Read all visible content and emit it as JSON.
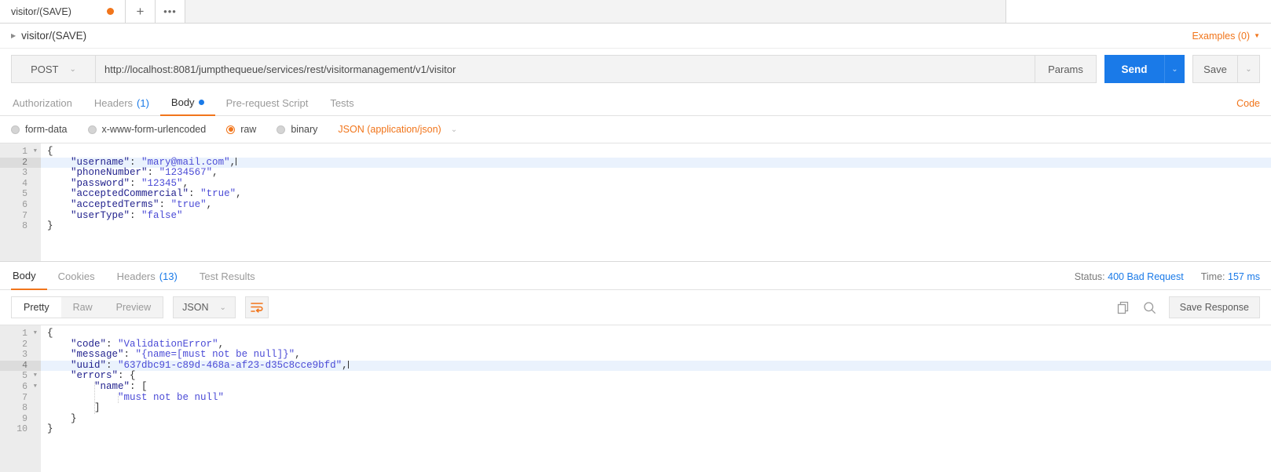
{
  "tabbar": {
    "request_tab_label": "visitor/(SAVE)",
    "unsaved_dot_color": "#f1751b",
    "new_tab_label": "+",
    "more_label": "•••"
  },
  "breadcrumb": {
    "caret": "▶",
    "label": "visitor/(SAVE)",
    "examples_label": "Examples (0)",
    "examples_caret": "▼",
    "accent_color": "#f1751b"
  },
  "urlbar": {
    "method": "POST",
    "method_caret": "⌄",
    "url": "http://localhost:8081/jumpthequeue/services/rest/visitormanagement/v1/visitor",
    "params_label": "Params",
    "send_label": "Send",
    "send_caret": "⌄",
    "send_color": "#1a7ae8",
    "save_label": "Save",
    "save_caret": "⌄"
  },
  "request_tabs": {
    "items": [
      {
        "label": "Authorization",
        "count": "",
        "active": false,
        "dot": false
      },
      {
        "label": "Headers",
        "count": "(1)",
        "active": false,
        "dot": false
      },
      {
        "label": "Body",
        "count": "",
        "active": true,
        "dot": true
      },
      {
        "label": "Pre-request Script",
        "count": "",
        "active": false,
        "dot": false
      },
      {
        "label": "Tests",
        "count": "",
        "active": false,
        "dot": false
      }
    ],
    "code_link": "Code"
  },
  "body_types": {
    "options": [
      {
        "label": "form-data",
        "selected": false
      },
      {
        "label": "x-www-form-urlencoded",
        "selected": false
      },
      {
        "label": "raw",
        "selected": true
      },
      {
        "label": "binary",
        "selected": false
      }
    ],
    "content_type": "JSON (application/json)",
    "content_type_caret": "⌄"
  },
  "request_body": {
    "lines": [
      {
        "n": "1",
        "fold": true,
        "highlight": false,
        "indent": 0,
        "segments": [
          {
            "t": "{",
            "c": "p"
          }
        ]
      },
      {
        "n": "2",
        "fold": false,
        "highlight": true,
        "indent": 1,
        "segments": [
          {
            "t": "\"username\"",
            "c": "k"
          },
          {
            "t": ": ",
            "c": "p"
          },
          {
            "t": "\"mary@mail.com\"",
            "c": "s"
          },
          {
            "t": ",",
            "c": "p"
          }
        ],
        "caret": true
      },
      {
        "n": "3",
        "fold": false,
        "highlight": false,
        "indent": 1,
        "segments": [
          {
            "t": "\"phoneNumber\"",
            "c": "k"
          },
          {
            "t": ": ",
            "c": "p"
          },
          {
            "t": "\"1234567\"",
            "c": "s"
          },
          {
            "t": ",",
            "c": "p"
          }
        ]
      },
      {
        "n": "4",
        "fold": false,
        "highlight": false,
        "indent": 1,
        "segments": [
          {
            "t": "\"password\"",
            "c": "k"
          },
          {
            "t": ": ",
            "c": "p"
          },
          {
            "t": "\"12345\"",
            "c": "s"
          },
          {
            "t": ",",
            "c": "p"
          }
        ]
      },
      {
        "n": "5",
        "fold": false,
        "highlight": false,
        "indent": 1,
        "segments": [
          {
            "t": "\"acceptedCommercial\"",
            "c": "k"
          },
          {
            "t": ": ",
            "c": "p"
          },
          {
            "t": "\"true\"",
            "c": "s"
          },
          {
            "t": ",",
            "c": "p"
          }
        ]
      },
      {
        "n": "6",
        "fold": false,
        "highlight": false,
        "indent": 1,
        "segments": [
          {
            "t": "\"acceptedTerms\"",
            "c": "k"
          },
          {
            "t": ": ",
            "c": "p"
          },
          {
            "t": "\"true\"",
            "c": "s"
          },
          {
            "t": ",",
            "c": "p"
          }
        ]
      },
      {
        "n": "7",
        "fold": false,
        "highlight": false,
        "indent": 1,
        "segments": [
          {
            "t": "\"userType\"",
            "c": "k"
          },
          {
            "t": ": ",
            "c": "p"
          },
          {
            "t": "\"false\"",
            "c": "s"
          }
        ]
      },
      {
        "n": "8",
        "fold": false,
        "highlight": false,
        "indent": 0,
        "segments": [
          {
            "t": "}",
            "c": "p"
          }
        ]
      }
    ]
  },
  "response_tabs": {
    "items": [
      {
        "label": "Body",
        "count": "",
        "active": true
      },
      {
        "label": "Cookies",
        "count": "",
        "active": false
      },
      {
        "label": "Headers",
        "count": "(13)",
        "active": false
      },
      {
        "label": "Test Results",
        "count": "",
        "active": false
      }
    ],
    "status_label": "Status:",
    "status_value": "400 Bad Request",
    "time_label": "Time:",
    "time_value": "157 ms",
    "value_color": "#1a7ae8"
  },
  "response_toolbar": {
    "views": [
      {
        "label": "Pretty",
        "active": true
      },
      {
        "label": "Raw",
        "active": false
      },
      {
        "label": "Preview",
        "active": false
      }
    ],
    "format": "JSON",
    "format_caret": "⌄",
    "wrap_icon": "wrap-lines-icon",
    "copy_icon": "copy-icon",
    "search_icon": "search-icon",
    "save_response_label": "Save Response"
  },
  "response_body": {
    "lines": [
      {
        "n": "1",
        "fold": true,
        "highlight": false,
        "indent": 0,
        "segments": [
          {
            "t": "{",
            "c": "p"
          }
        ]
      },
      {
        "n": "2",
        "fold": false,
        "highlight": false,
        "indent": 1,
        "segments": [
          {
            "t": "\"code\"",
            "c": "k"
          },
          {
            "t": ": ",
            "c": "p"
          },
          {
            "t": "\"ValidationError\"",
            "c": "s"
          },
          {
            "t": ",",
            "c": "p"
          }
        ]
      },
      {
        "n": "3",
        "fold": false,
        "highlight": false,
        "indent": 1,
        "segments": [
          {
            "t": "\"message\"",
            "c": "k"
          },
          {
            "t": ": ",
            "c": "p"
          },
          {
            "t": "\"{name=[must not be null]}\"",
            "c": "s"
          },
          {
            "t": ",",
            "c": "p"
          }
        ]
      },
      {
        "n": "4",
        "fold": false,
        "highlight": true,
        "indent": 1,
        "segments": [
          {
            "t": "\"uuid\"",
            "c": "k"
          },
          {
            "t": ": ",
            "c": "p"
          },
          {
            "t": "\"637dbc91-c89d-468a-af23-d35c8cce9bfd\"",
            "c": "s"
          },
          {
            "t": ",",
            "c": "p"
          }
        ],
        "caret": true
      },
      {
        "n": "5",
        "fold": true,
        "highlight": false,
        "indent": 1,
        "segments": [
          {
            "t": "\"errors\"",
            "c": "k"
          },
          {
            "t": ": {",
            "c": "p"
          }
        ]
      },
      {
        "n": "6",
        "fold": true,
        "highlight": false,
        "indent": 2,
        "segments": [
          {
            "t": "\"name\"",
            "c": "k"
          },
          {
            "t": ": [",
            "c": "p"
          }
        ]
      },
      {
        "n": "7",
        "fold": false,
        "highlight": false,
        "indent": 3,
        "segments": [
          {
            "t": "\"must not be null\"",
            "c": "s"
          }
        ]
      },
      {
        "n": "8",
        "fold": false,
        "highlight": false,
        "indent": 2,
        "segments": [
          {
            "t": "]",
            "c": "p"
          }
        ]
      },
      {
        "n": "9",
        "fold": false,
        "highlight": false,
        "indent": 1,
        "segments": [
          {
            "t": "}",
            "c": "p"
          }
        ]
      },
      {
        "n": "10",
        "fold": false,
        "highlight": false,
        "indent": 0,
        "segments": [
          {
            "t": "}",
            "c": "p"
          }
        ]
      }
    ]
  }
}
